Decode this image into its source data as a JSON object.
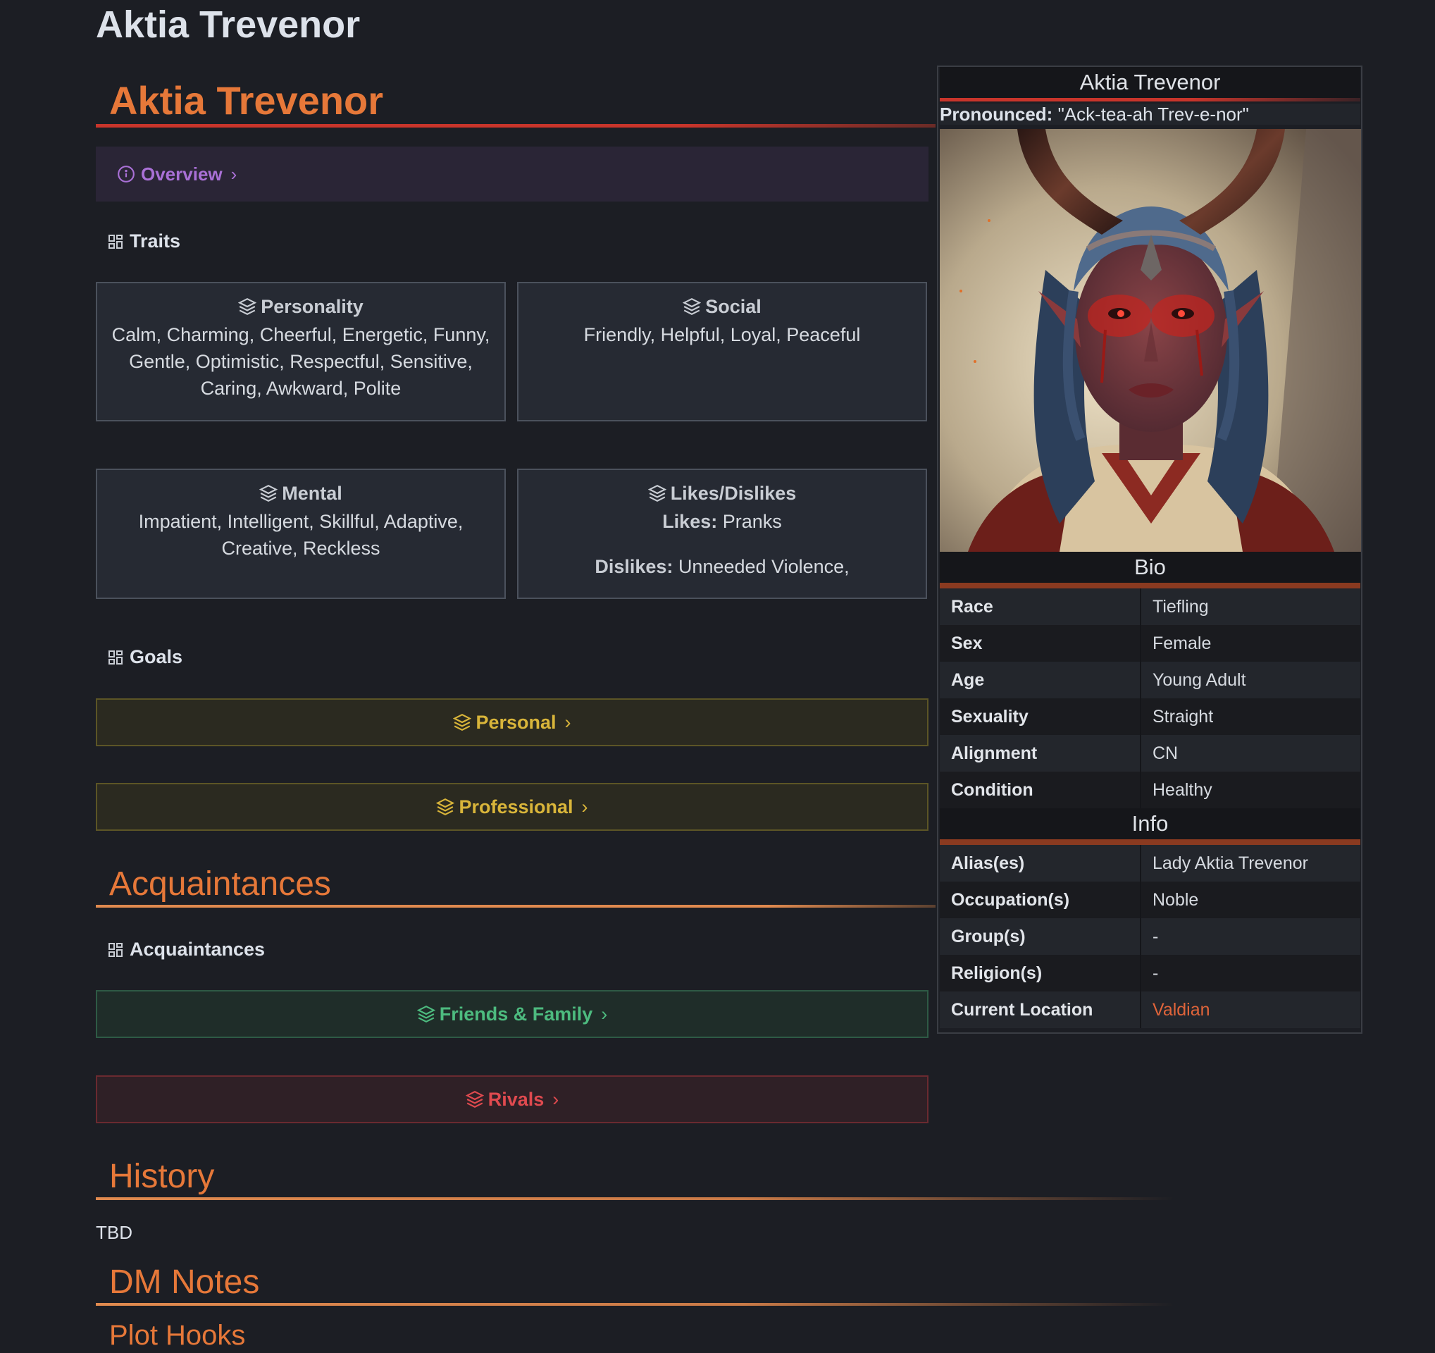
{
  "page_title": "Aktia Trevenor",
  "heading_name": "Aktia Trevenor",
  "overview": {
    "label": "Overview",
    "chevron": "›"
  },
  "traits": {
    "label": "Traits",
    "cards": [
      {
        "title": "Personality",
        "text": "Calm, Charming, Cheerful, Energetic, Funny, Gentle, Optimistic, Respectful, Sensitive, Caring, Awkward, Polite"
      },
      {
        "title": "Social",
        "text": "Friendly, Helpful, Loyal, Peaceful"
      },
      {
        "title": "Mental",
        "text": "Impatient, Intelligent, Skillful, Adaptive, Creative, Reckless"
      },
      {
        "title": "Likes/Dislikes",
        "likes_label": "Likes:",
        "likes": "Pranks",
        "dislikes_label": "Dislikes:",
        "dislikes": "Unneeded Violence,"
      }
    ]
  },
  "goals": {
    "label": "Goals",
    "items": [
      {
        "label": "Personal",
        "chevron": "›"
      },
      {
        "label": "Professional",
        "chevron": "›"
      }
    ]
  },
  "acquaintances": {
    "heading": "Acquaintances",
    "label": "Acquaintances",
    "items": [
      {
        "label": "Friends & Family",
        "chevron": "›"
      },
      {
        "label": "Rivals",
        "chevron": "›"
      }
    ]
  },
  "history": {
    "heading": "History",
    "text": "TBD"
  },
  "dm_notes": {
    "heading": "DM Notes",
    "sub": "Plot Hooks"
  },
  "infobox": {
    "title": "Aktia Trevenor",
    "pronounced_label": "Pronounced:",
    "pronounced_value": "\"Ack-tea-ah Trev-e-nor\"",
    "bio_heading": "Bio",
    "bio": [
      {
        "k": "Race",
        "v": "Tiefling"
      },
      {
        "k": "Sex",
        "v": "Female"
      },
      {
        "k": "Age",
        "v": "Young Adult"
      },
      {
        "k": "Sexuality",
        "v": "Straight"
      },
      {
        "k": "Alignment",
        "v": "CN"
      },
      {
        "k": "Condition",
        "v": "Healthy"
      }
    ],
    "info_heading": "Info",
    "info": [
      {
        "k": "Alias(es)",
        "v": "Lady Aktia Trevenor"
      },
      {
        "k": "Occupation(s)",
        "v": "Noble"
      },
      {
        "k": "Group(s)",
        "v": "-"
      },
      {
        "k": "Religion(s)",
        "v": "-"
      },
      {
        "k": "Current Location",
        "v": "Valdian"
      }
    ]
  },
  "colors": {
    "background": "#1c1e24",
    "heading_orange": "#e67839",
    "overview_purple": "#a970d6",
    "goal_yellow": "#d9b53a",
    "friends_green": "#4dbb7f",
    "rivals_red": "#e04a4f",
    "link_orange": "#e0643a"
  }
}
